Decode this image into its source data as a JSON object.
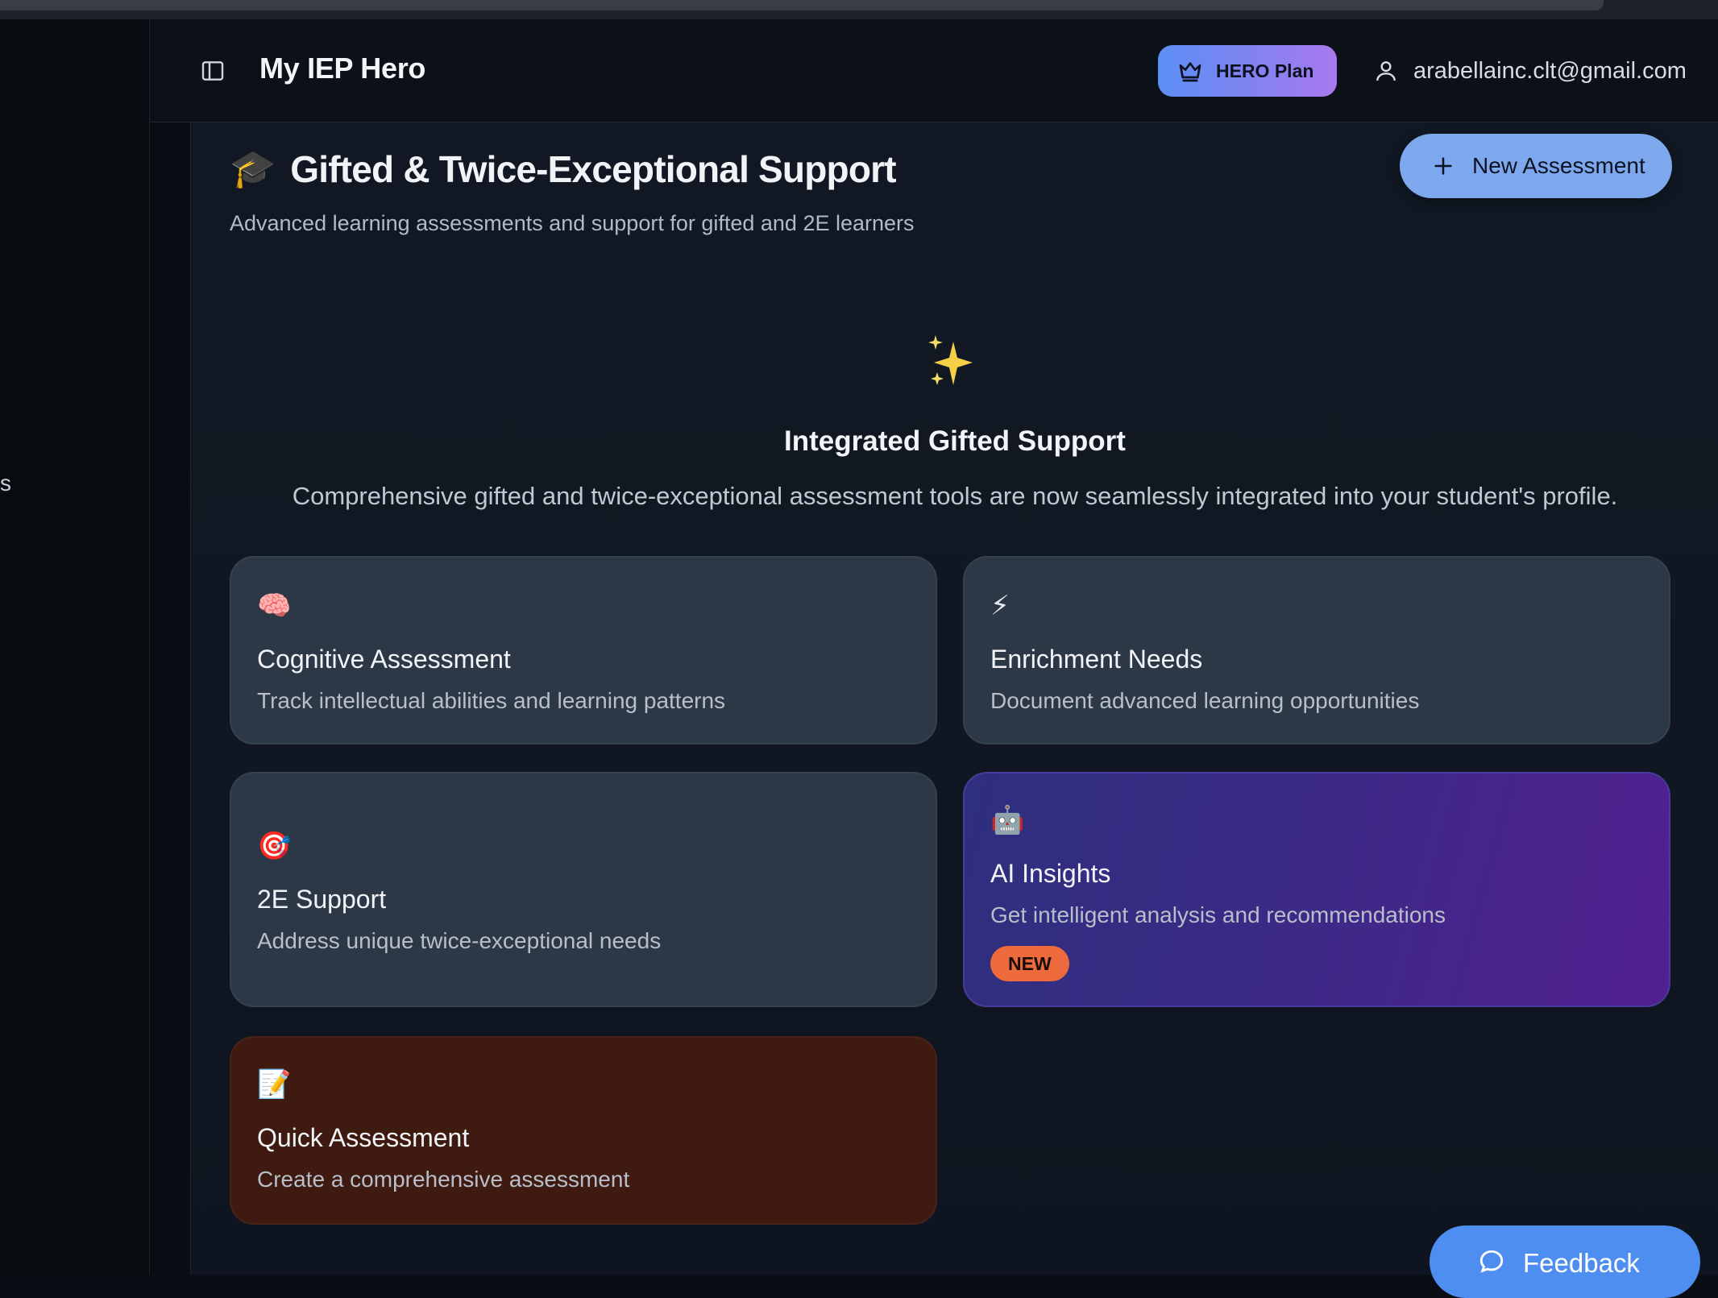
{
  "header": {
    "app_title": "My IEP Hero",
    "plan_label": "HERO Plan",
    "user_email": "arabellainc.clt@gmail.com",
    "sidebar_fragment": "s"
  },
  "page": {
    "title": "Gifted & Twice-Exceptional Support",
    "subtitle": "Advanced learning assessments and support for gifted and 2E learners",
    "new_button_label": "New Assessment"
  },
  "intro": {
    "icon": "✨",
    "title": "Integrated Gifted Support",
    "description": "Comprehensive gifted and twice-exceptional assessment tools are now seamlessly integrated into your student's profile."
  },
  "cards": [
    {
      "icon": "🧠",
      "title": "Cognitive Assessment",
      "description": "Track intellectual abilities and learning patterns"
    },
    {
      "icon": "⚡",
      "title": "Enrichment Needs",
      "description": "Document advanced learning opportunities"
    },
    {
      "icon": "🎯",
      "title": "2E Support",
      "description": "Address unique twice-exceptional needs"
    },
    {
      "icon": "🤖",
      "title": "AI Insights",
      "description": "Get intelligent analysis and recommendations",
      "badge": "NEW"
    },
    {
      "icon": "📝",
      "title": "Quick Assessment",
      "description": "Create a comprehensive assessment"
    }
  ],
  "feedback": {
    "label": "Feedback"
  },
  "colors": {
    "accent_blue": "#7ea8ee",
    "plan_gradient_start": "#5b8ff5",
    "plan_gradient_end": "#a979ef",
    "badge_new": "#ec6a3c",
    "card_default": "#2d3846",
    "card_ai": "#3b2a85",
    "card_quick": "#3e1a10"
  }
}
